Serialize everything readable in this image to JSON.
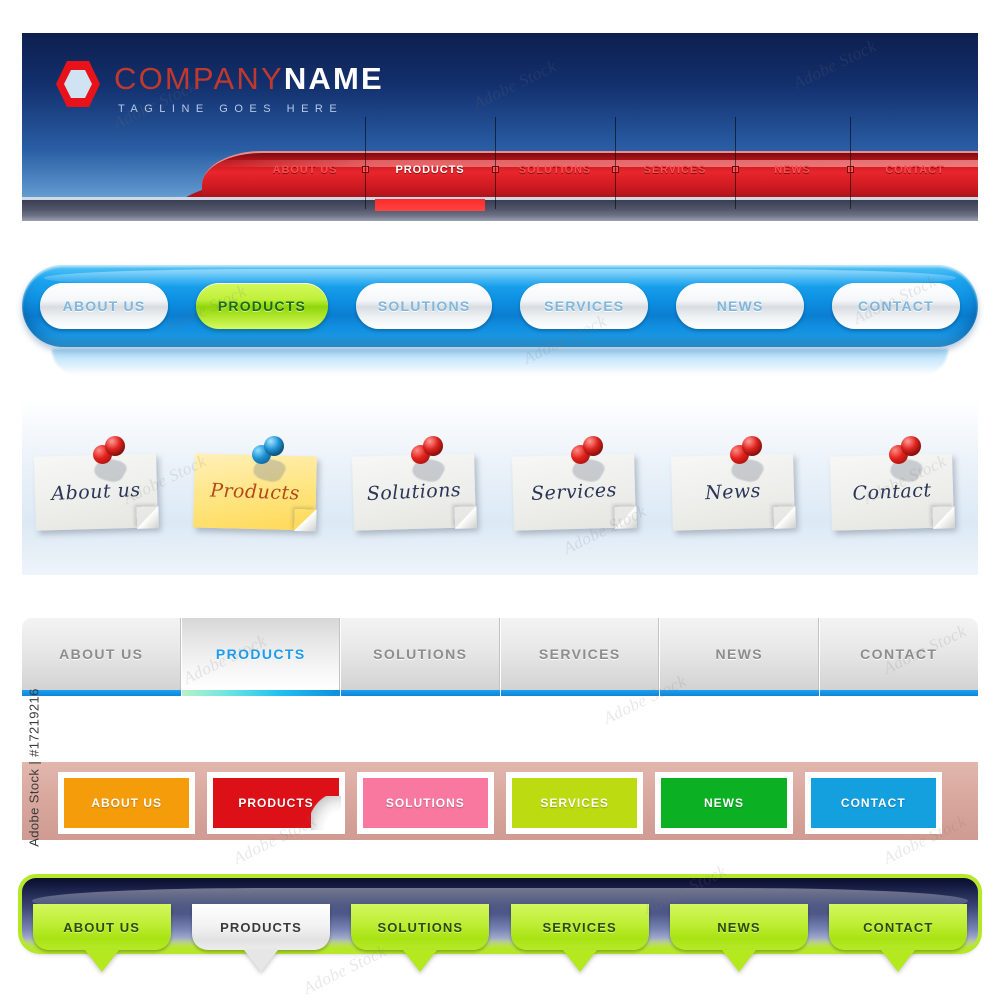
{
  "watermark": {
    "id_text": "Adobe Stock | #17219216",
    "tile_text": "Adobe Stock"
  },
  "header_banner": {
    "logo_icon": "hexagon-logo",
    "company_name_part1": "COMPANY",
    "company_name_part2": "NAME",
    "tagline": "TAGLINE GOES HERE",
    "nav": [
      {
        "label": "ABOUT US",
        "active": false
      },
      {
        "label": "PRODUCTS",
        "active": true
      },
      {
        "label": "SOLUTIONS",
        "active": false
      },
      {
        "label": "SERVICES",
        "active": false
      },
      {
        "label": "NEWS",
        "active": false
      },
      {
        "label": "CONTACT",
        "active": false
      }
    ],
    "colors": {
      "bg_dark": "#0d1f4e",
      "bg_light": "#9ec4e4",
      "accent_red": "#e8262c",
      "active_text": "#ffffff"
    }
  },
  "blue_pill_bar": {
    "items": [
      {
        "label": "ABOUT US",
        "active": false
      },
      {
        "label": "PRODUCTS",
        "active": true
      },
      {
        "label": "SOLUTIONS",
        "active": false
      },
      {
        "label": "SERVICES",
        "active": false
      },
      {
        "label": "NEWS",
        "active": false
      },
      {
        "label": "CONTACT",
        "active": false
      }
    ],
    "colors": {
      "bar": "#0d8de0",
      "pill": "#f4f7f9",
      "pill_text": "#7fb7dd",
      "active_pill": "#8fd60c",
      "active_text": "#1d6b12"
    }
  },
  "sticky_notes": {
    "items": [
      {
        "label": "About us",
        "pin": "red",
        "paper": "white"
      },
      {
        "label": "Products",
        "pin": "blue",
        "paper": "yellow"
      },
      {
        "label": "Solutions",
        "pin": "red",
        "paper": "white"
      },
      {
        "label": "Services",
        "pin": "red",
        "paper": "white"
      },
      {
        "label": "News",
        "pin": "red",
        "paper": "white"
      },
      {
        "label": "Contact",
        "pin": "red",
        "paper": "white"
      }
    ],
    "colors": {
      "paper_white": "#f1f1ee",
      "paper_yellow": "#ffe47f",
      "pin_red": "#e2201b",
      "pin_blue": "#1d8fd0",
      "ink": "#2b3558",
      "ink_active": "#b4491a"
    }
  },
  "gray_tabs": {
    "items": [
      {
        "label": "ABOUT US",
        "active": false
      },
      {
        "label": "PRODUCTS",
        "active": true
      },
      {
        "label": "SOLUTIONS",
        "active": false
      },
      {
        "label": "SERVICES",
        "active": false
      },
      {
        "label": "NEWS",
        "active": false
      },
      {
        "label": "CONTACT",
        "active": false
      }
    ],
    "colors": {
      "tab": "#e9e9e9",
      "text": "#8d8d8d",
      "active_text": "#1a9cf0",
      "underline": "#1e9ff2"
    }
  },
  "color_blocks": {
    "band_color": "#d9a89f",
    "items": [
      {
        "label": "ABOUT US",
        "color": "#f59c0b",
        "active": false
      },
      {
        "label": "PRODUCTS",
        "color": "#dd1017",
        "active": true
      },
      {
        "label": "SOLUTIONS",
        "color": "#f9789f",
        "active": false
      },
      {
        "label": "SERVICES",
        "color": "#bcdb10",
        "active": false
      },
      {
        "label": "NEWS",
        "color": "#0bb023",
        "active": false
      },
      {
        "label": "CONTACT",
        "color": "#149fdf",
        "active": false
      }
    ]
  },
  "green_tab_bar": {
    "items": [
      {
        "label": "ABOUT US",
        "active": false
      },
      {
        "label": "PRODUCTS",
        "active": true
      },
      {
        "label": "SOLUTIONS",
        "active": false
      },
      {
        "label": "SERVICES",
        "active": false
      },
      {
        "label": "NEWS",
        "active": false
      },
      {
        "label": "CONTACT",
        "active": false
      }
    ],
    "colors": {
      "outline": "#b6e82a",
      "bar_dark": "#0a0e2a",
      "bar_light": "#c9d0e4",
      "tab": "#bdee33",
      "tab_text": "#2e4c08",
      "active_tab": "#f3f3f3",
      "active_text": "#3a3a3a"
    }
  }
}
